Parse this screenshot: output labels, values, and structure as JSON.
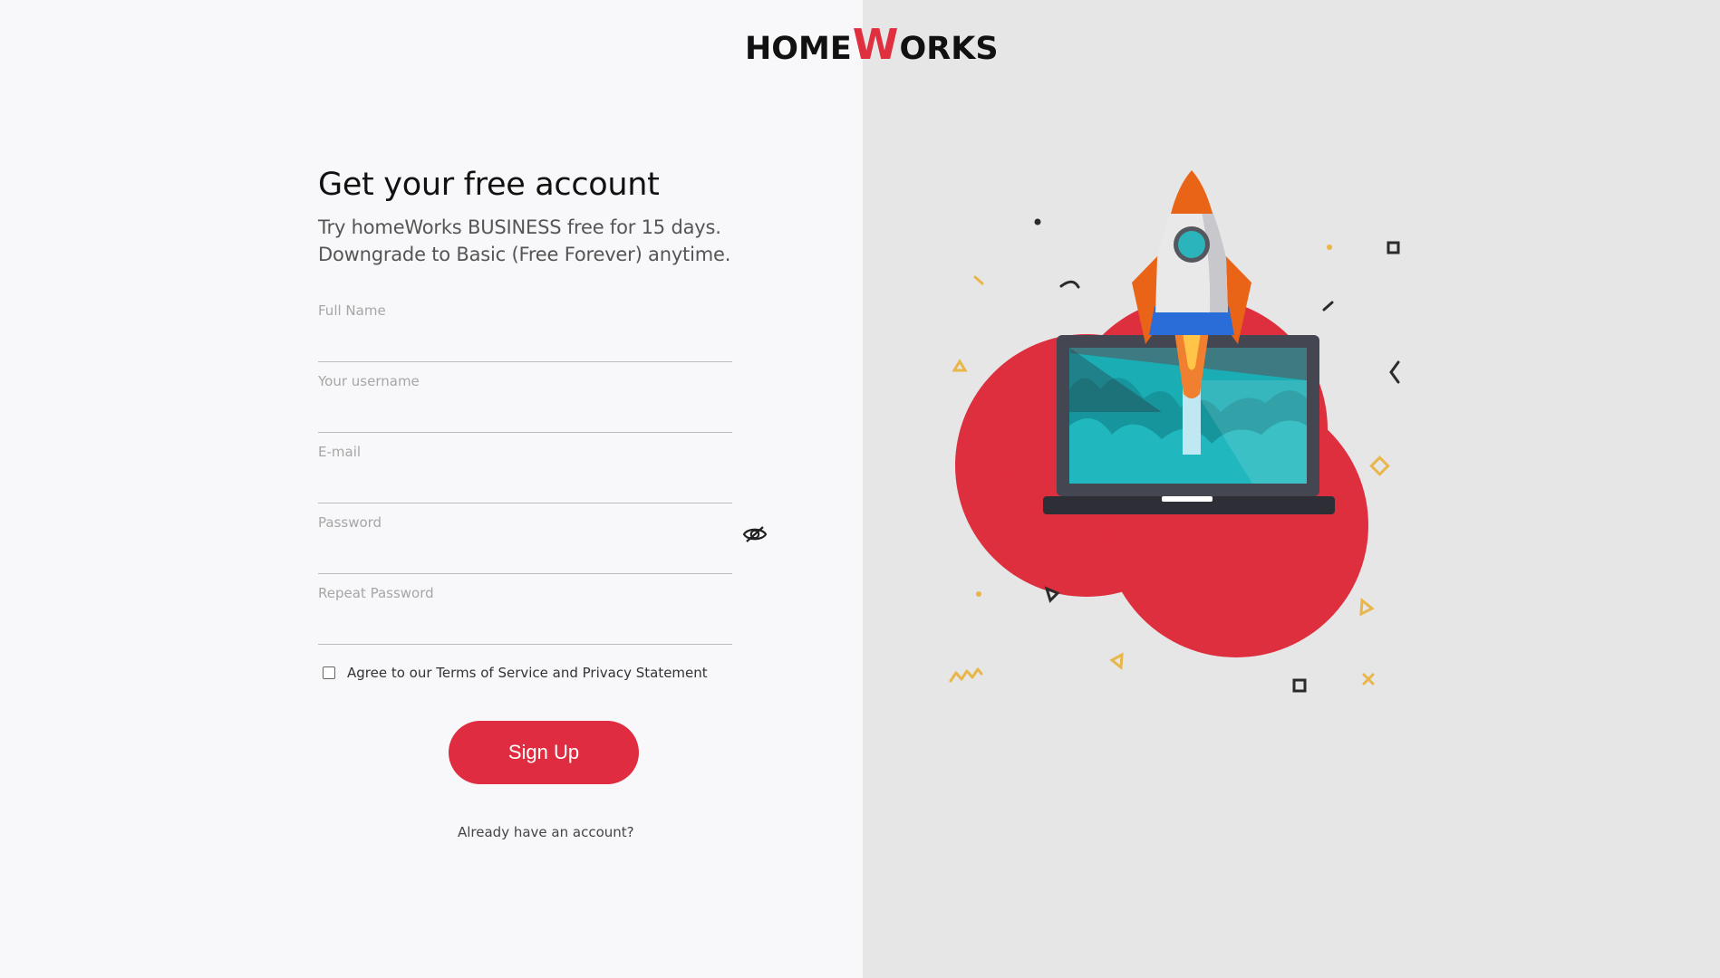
{
  "logo": {
    "part1": "HOME",
    "part2": "W",
    "part3": "ORKS",
    "accent_color": "#e0303f"
  },
  "heading": {
    "title": "Get your free account",
    "subtitle_line1": "Try homeWorks BUSINESS free for 15 days.",
    "subtitle_line2": "Downgrade to Basic (Free Forever) anytime."
  },
  "form": {
    "full_name_label": "Full Name",
    "username_label": "Your username",
    "email_label": "E-mail",
    "password_label": "Password",
    "repeat_password_label": "Repeat Password",
    "password_toggle_icon": "eye-slash-icon",
    "terms_text": "Agree to our Terms of Service and Privacy Statement",
    "terms_checked": false,
    "signup_label": "Sign Up",
    "login_link": "Already have an account?"
  },
  "colors": {
    "primary": "#e02c40",
    "left_background": "#f8f8fa",
    "right_background": "#e6e6e6"
  },
  "illustration": {
    "icon": "rocket-laptop-illustration"
  }
}
